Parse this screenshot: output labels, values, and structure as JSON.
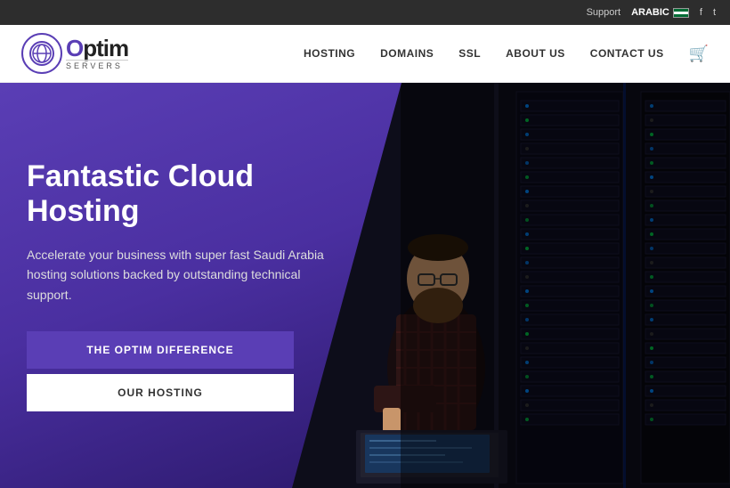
{
  "topbar": {
    "support_label": "Support",
    "arabic_label": "ARABIC",
    "facebook_icon": "f",
    "twitter_icon": "t"
  },
  "header": {
    "logo_main": "ptim",
    "logo_sub": "SERVERS",
    "nav": {
      "hosting": "HOSTING",
      "domains": "DOMAINS",
      "ssl": "SSL",
      "about": "ABOUT US",
      "contact": "CONTACT US"
    }
  },
  "hero": {
    "title": "Fantastic Cloud Hosting",
    "subtitle": "Accelerate your business with super fast Saudi Arabia hosting solutions backed by outstanding technical support.",
    "btn_primary": "THE OPTIM DIFFERENCE",
    "btn_secondary": "OUR HOSTING"
  },
  "rack_units": [
    {
      "lights": [
        "blue",
        "off",
        "green"
      ]
    },
    {
      "lights": [
        "off",
        "blue",
        "off"
      ]
    },
    {
      "lights": [
        "green",
        "off",
        "blue"
      ]
    },
    {
      "lights": [
        "blue",
        "green",
        "off"
      ]
    },
    {
      "lights": [
        "off",
        "off",
        "green"
      ]
    },
    {
      "lights": [
        "blue",
        "off",
        "off"
      ]
    },
    {
      "lights": [
        "green",
        "blue",
        "off"
      ]
    },
    {
      "lights": [
        "off",
        "green",
        "blue"
      ]
    },
    {
      "lights": [
        "blue",
        "off",
        "green"
      ]
    },
    {
      "lights": [
        "off",
        "blue",
        "off"
      ]
    },
    {
      "lights": [
        "green",
        "off",
        "blue"
      ]
    },
    {
      "lights": [
        "blue",
        "green",
        "off"
      ]
    },
    {
      "lights": [
        "off",
        "off",
        "green"
      ]
    },
    {
      "lights": [
        "blue",
        "off",
        "off"
      ]
    },
    {
      "lights": [
        "green",
        "blue",
        "off"
      ]
    },
    {
      "lights": [
        "off",
        "green",
        "blue"
      ]
    },
    {
      "lights": [
        "blue",
        "off",
        "green"
      ]
    },
    {
      "lights": [
        "off",
        "blue",
        "off"
      ]
    },
    {
      "lights": [
        "green",
        "off",
        "blue"
      ]
    },
    {
      "lights": [
        "blue",
        "green",
        "off"
      ]
    }
  ]
}
